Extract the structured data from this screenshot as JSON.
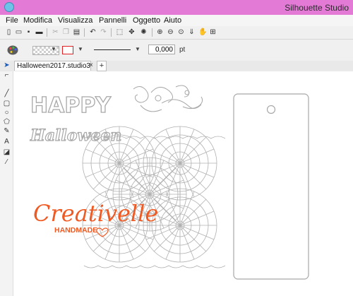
{
  "app": {
    "title": "Silhouette Studio"
  },
  "menu": [
    "File",
    "Modifica",
    "Visualizza",
    "Pannelli",
    "Oggetto",
    "Aiuto"
  ],
  "toolbar": {
    "icons": [
      "new-document-icon",
      "open-folder-icon",
      "save-icon",
      "print-icon",
      "cut-icon",
      "copy-icon",
      "paste-icon",
      "undo-icon",
      "redo-icon",
      "select-all-icon",
      "deselect-icon",
      "zoom-in-icon",
      "zoom-out-icon",
      "zoom-fit-icon",
      "move-down-icon",
      "pan-hand-icon",
      "fit-page-icon"
    ]
  },
  "line_settings": {
    "weight": "0,000",
    "unit": "pt",
    "line_color": "#e02020"
  },
  "document": {
    "tab_label": "Halloween2017.studio3",
    "close_glyph": "×",
    "add_glyph": "+"
  },
  "canvas_text": {
    "happy": "HAPPY",
    "halloween": "Halloween",
    "creativelle": "Creativelle",
    "handmade": "HANDMADE"
  },
  "colors": {
    "accent_title": "#e27ad6",
    "brand_orange": "#f05a22",
    "outline": "#b0b0b0"
  }
}
